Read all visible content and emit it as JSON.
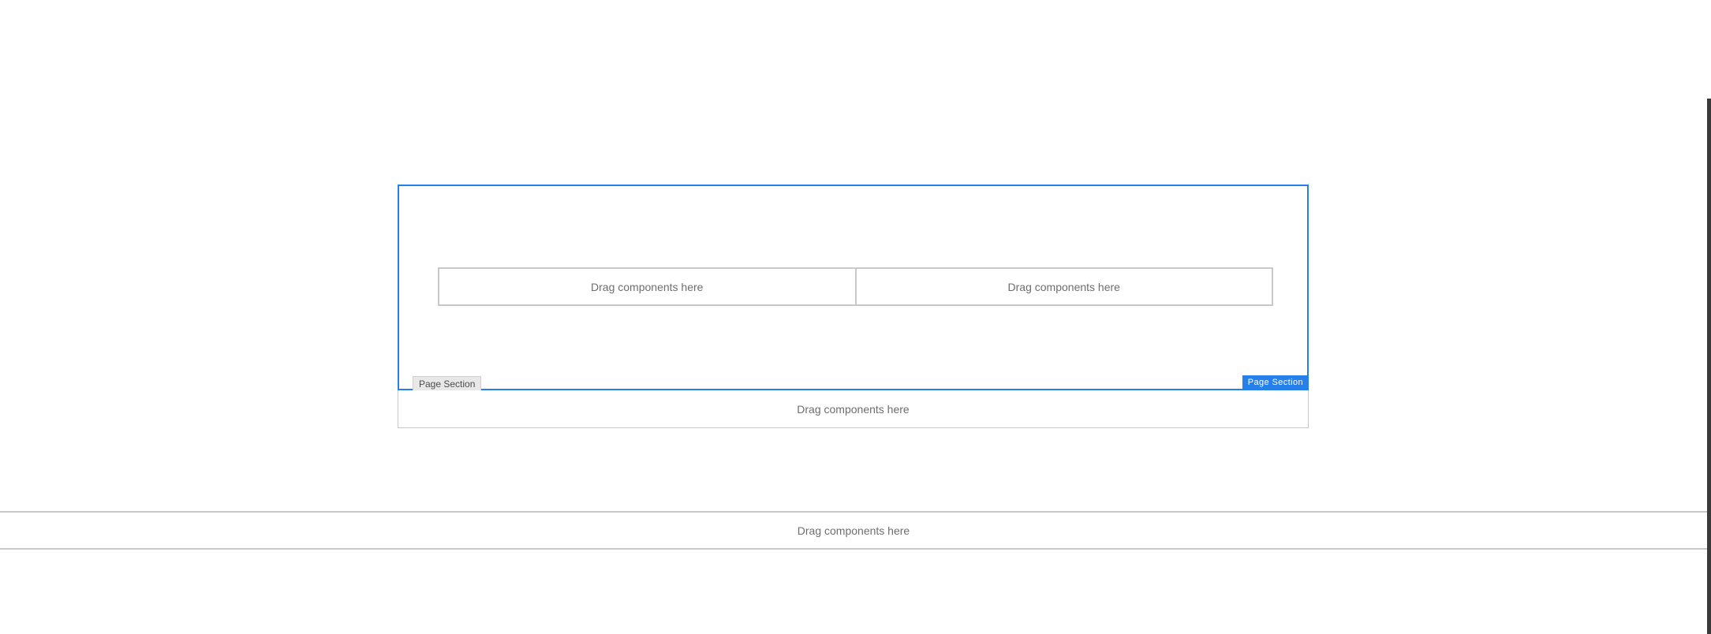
{
  "editor": {
    "page_section": {
      "tag_left_label": "Page Section",
      "tag_right_label": "Page Section",
      "accent_color": "#2680eb",
      "columns": [
        {
          "placeholder": "Drag components here"
        },
        {
          "placeholder": "Drag components here"
        }
      ]
    },
    "section_drop": {
      "placeholder": "Drag components here"
    },
    "page_drop": {
      "placeholder": "Drag components here"
    }
  }
}
